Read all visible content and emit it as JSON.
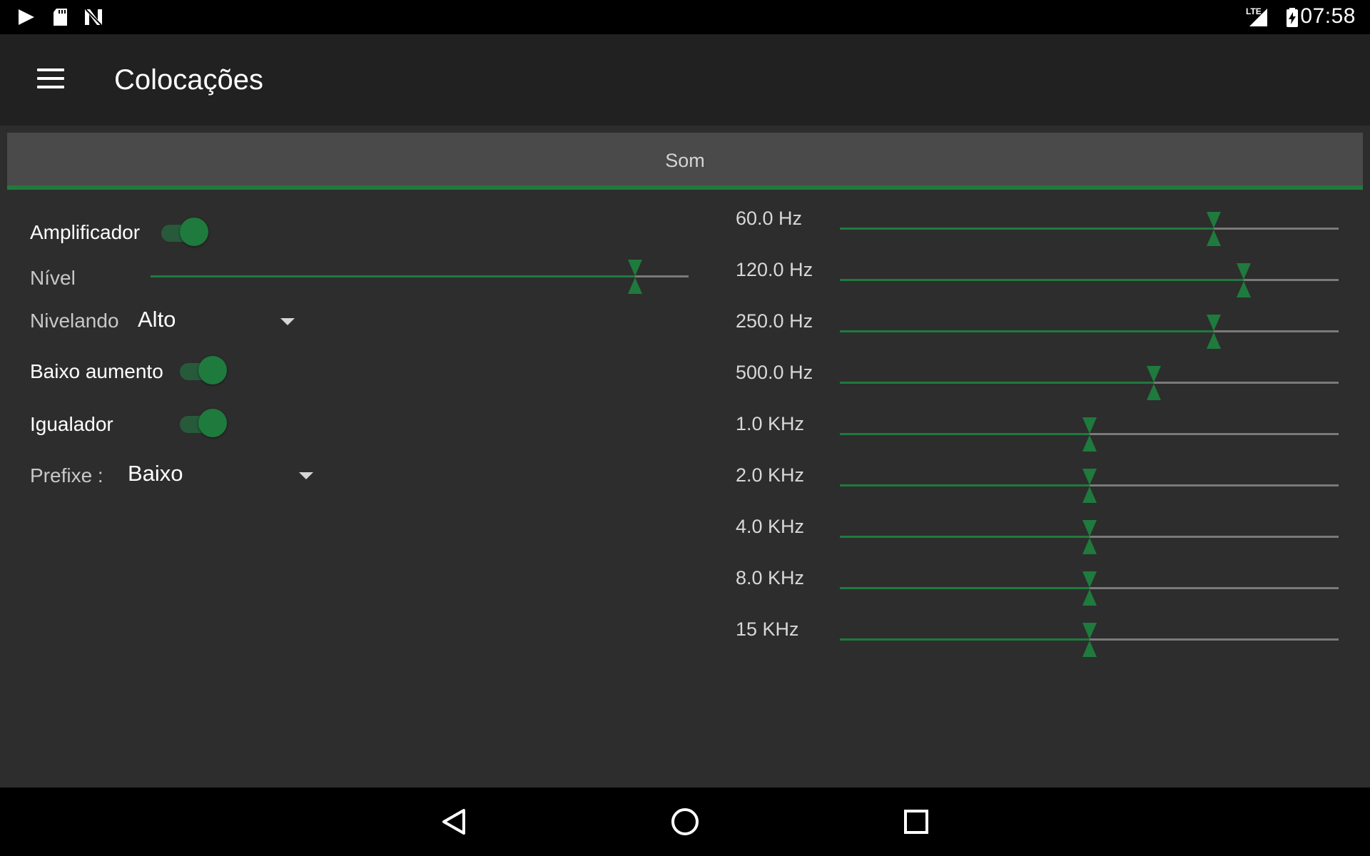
{
  "status_bar": {
    "time": "07:58",
    "network": "LTE",
    "icons": [
      "play-icon",
      "sd-card-icon",
      "n-icon",
      "signal-icon",
      "battery-charging-icon"
    ]
  },
  "toolbar": {
    "title": "Colocações",
    "menu_icon": "hamburger-menu-icon"
  },
  "tabs": [
    {
      "label": "Som",
      "selected": true
    }
  ],
  "settings": {
    "amplifier": {
      "label": "Amplificador",
      "on": true
    },
    "level": {
      "label": "Nível",
      "value": 0.9
    },
    "leveling": {
      "label": "Nivelando",
      "value": "Alto"
    },
    "bass_boost": {
      "label": "Baixo aumento",
      "on": true
    },
    "equalizer": {
      "label": "Igualador",
      "on": true
    },
    "preset": {
      "label": "Prefixe :",
      "value": "Baixo"
    }
  },
  "equalizer_bands": [
    {
      "label": "60.0 Hz",
      "value": 0.75
    },
    {
      "label": "120.0 Hz",
      "value": 0.81
    },
    {
      "label": "250.0 Hz",
      "value": 0.75
    },
    {
      "label": "500.0 Hz",
      "value": 0.63
    },
    {
      "label": "1.0 KHz",
      "value": 0.5
    },
    {
      "label": "2.0 KHz",
      "value": 0.5
    },
    {
      "label": "4.0 KHz",
      "value": 0.5
    },
    {
      "label": "8.0 KHz",
      "value": 0.5
    },
    {
      "label": "15 KHz",
      "value": 0.5
    }
  ],
  "colors": {
    "accent": "#1f7a3d",
    "background": "#2d2d2d",
    "toolbar": "#212121",
    "tab": "#4a4a4a"
  },
  "nav_bar": {
    "buttons": [
      "back-icon",
      "home-icon",
      "recents-icon"
    ]
  }
}
